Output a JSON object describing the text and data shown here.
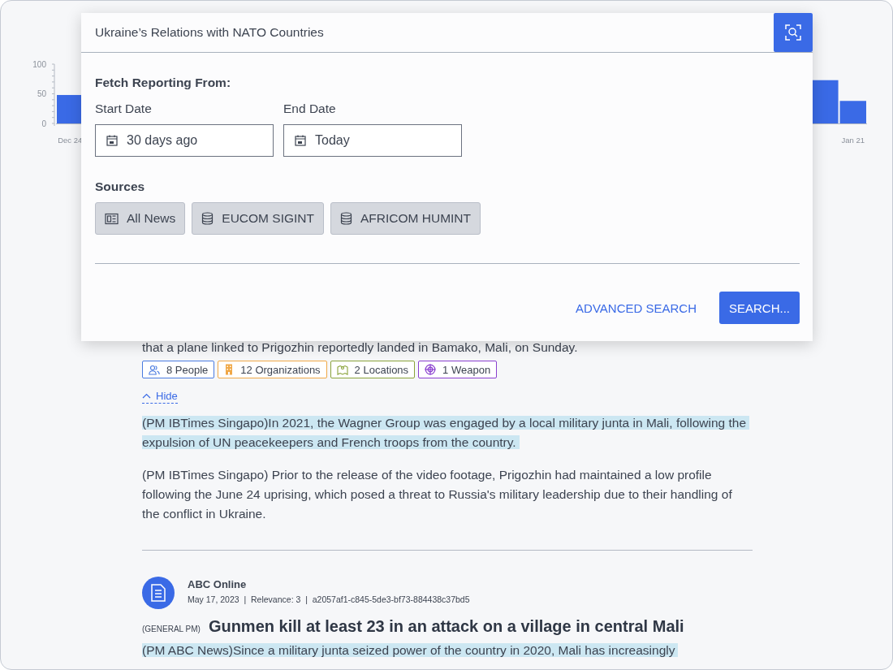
{
  "chart": {
    "chart_data": {
      "type": "bar",
      "ylim": [
        0,
        100
      ],
      "yticks": [
        0,
        50,
        100
      ],
      "categories": [
        "Dec 24",
        null,
        null,
        null,
        null,
        null,
        null,
        null,
        null,
        null,
        null,
        null,
        null,
        null,
        null,
        null,
        null,
        null,
        null,
        null,
        null,
        null,
        null,
        null,
        null,
        null,
        null,
        null,
        "Jan 21"
      ],
      "values": [
        48,
        null,
        null,
        null,
        null,
        null,
        null,
        null,
        null,
        null,
        null,
        null,
        null,
        null,
        null,
        null,
        null,
        null,
        null,
        null,
        null,
        null,
        null,
        null,
        null,
        null,
        null,
        73,
        38
      ]
    }
  },
  "search_dialog": {
    "query": "Ukraine’s Relations with NATO Countries",
    "section_title": "Fetch Reporting From:",
    "start_date": {
      "label": "Start Date",
      "value": "30 days ago"
    },
    "end_date": {
      "label": "End Date",
      "value": "Today"
    },
    "sources_title": "Sources",
    "sources": [
      {
        "label": "All News",
        "kind": "news"
      },
      {
        "label": "EUCOM SIGINT",
        "kind": "database"
      },
      {
        "label": "AFRICOM HUMINT",
        "kind": "database"
      }
    ],
    "advanced_search": "ADVANCED SEARCH",
    "search_button": "SEARCH..."
  },
  "article": {
    "partial_sentence": "that a plane linked to Prigozhin reportedly landed in Bamako, Mali, on Sunday.",
    "entities": [
      {
        "label": "8 People",
        "kind": "people",
        "color": "#4a7be0"
      },
      {
        "label": "12 Organizations",
        "kind": "organization",
        "color": "#f0a847"
      },
      {
        "label": "2 Locations",
        "kind": "location",
        "color": "#8aa33a"
      },
      {
        "label": "1 Weapon",
        "kind": "weapon",
        "color": "#8a3fcf"
      }
    ],
    "toggle": "Hide",
    "excerpts": [
      {
        "text": "(PM IBTimes Singapo)In 2021, the Wagner Group was engaged by a local military junta in Mali, following the expulsion of UN peacekeepers and French troops from the country.",
        "highlighted": true
      },
      {
        "text": "(PM IBTimes Singapo) Prior to the release of the video footage, Prigozhin had maintained a low profile following the June 24 uprising, which posed a threat to Russia's military leadership due to their handling of the conflict in Ukraine.",
        "highlighted": false
      }
    ]
  },
  "result": {
    "source": "ABC Online",
    "meta": "May 17, 2023  |  Relevance: 3  |  a2057af1-c845-5de3-bf73-884438c37bd5",
    "tag": "(GENERAL PM)",
    "headline": "Gunmen kill at least 23 in an attack on a village in central Mali",
    "excerpt": {
      "text": "(PM ABC News)Since a military junta seized power of the country in 2020, Mali has increasingly",
      "highlighted": true
    }
  }
}
